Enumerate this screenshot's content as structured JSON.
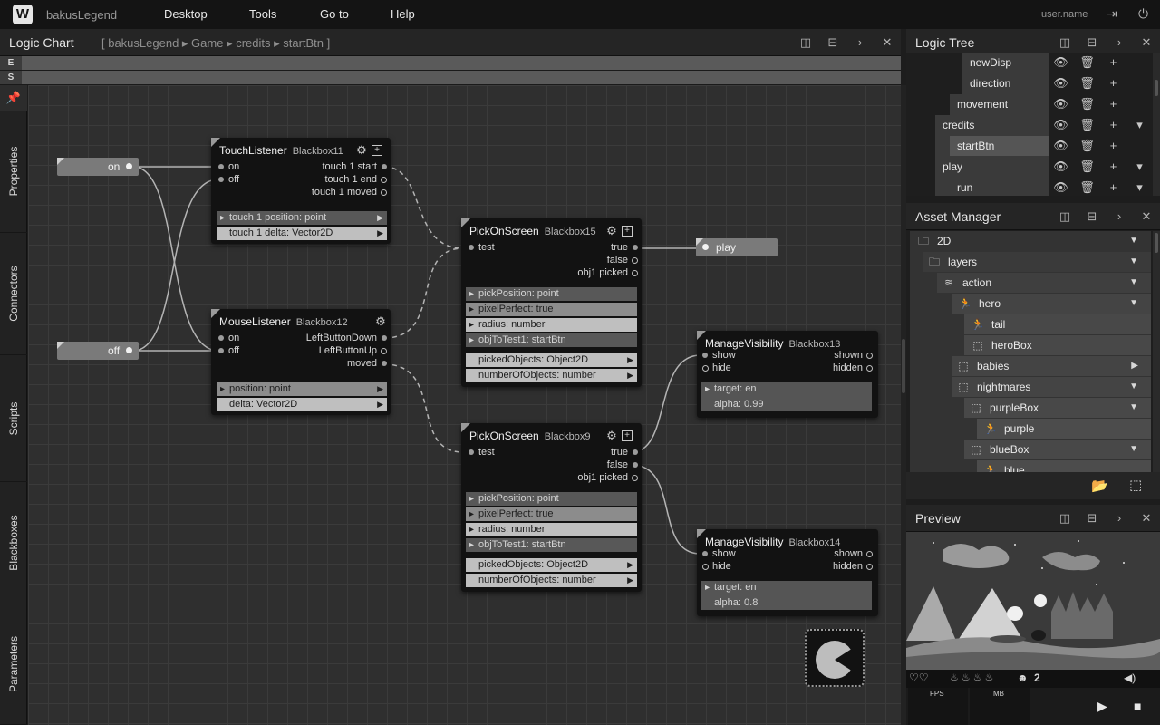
{
  "app": {
    "logo": "W",
    "name": "bakusLegend"
  },
  "menu": {
    "items": [
      "Desktop",
      "Tools",
      "Go to",
      "Help"
    ],
    "username": "user.name"
  },
  "logic_chart": {
    "title": "Logic Chart",
    "breadcrumb": "[ bakusLegend ▸ Game ▸ credits ▸ startBtn ]",
    "es": [
      "E",
      "S"
    ],
    "sidebar_tabs": [
      "Properties",
      "Connectors",
      "Scripts",
      "Blackboxes",
      "Parameters"
    ],
    "value_nodes": {
      "on": "on",
      "off": "off",
      "play": "play"
    },
    "nodes": {
      "touch": {
        "title": "TouchListener",
        "id": "Blackbox11",
        "inputs": [
          "on",
          "off"
        ],
        "outputs": [
          "touch 1 start",
          "touch 1 end",
          "touch 1 moved"
        ],
        "params": [
          "touch 1 position: point",
          "touch 1 delta: Vector2D"
        ]
      },
      "mouse": {
        "title": "MouseListener",
        "id": "Blackbox12",
        "inputs": [
          "on",
          "off"
        ],
        "outputs": [
          "LeftButtonDown",
          "LeftButtonUp",
          "moved"
        ],
        "params": [
          "position: point",
          "delta: Vector2D"
        ]
      },
      "pick15": {
        "title": "PickOnScreen",
        "id": "Blackbox15",
        "inputs": [
          "test"
        ],
        "outputs": [
          "true",
          "false",
          "obj1 picked"
        ],
        "params": [
          "pickPosition: point",
          "pixelPerfect: true",
          "radius: number",
          "objToTest1: startBtn"
        ],
        "results": [
          "pickedObjects: Object2D",
          "numberOfObjects: number"
        ]
      },
      "pick9": {
        "title": "PickOnScreen",
        "id": "Blackbox9",
        "inputs": [
          "test"
        ],
        "outputs": [
          "true",
          "false",
          "obj1 picked"
        ],
        "params": [
          "pickPosition: point",
          "pixelPerfect: true",
          "radius: number",
          "objToTest1: startBtn"
        ],
        "results": [
          "pickedObjects: Object2D",
          "numberOfObjects: number"
        ]
      },
      "vis13": {
        "title": "ManageVisibility",
        "id": "Blackbox13",
        "inputs": [
          "show",
          "hide"
        ],
        "outputs": [
          "shown",
          "hidden"
        ],
        "params": [
          "target: en",
          "alpha: 0.99"
        ]
      },
      "vis14": {
        "title": "ManageVisibility",
        "id": "Blackbox14",
        "inputs": [
          "show",
          "hide"
        ],
        "outputs": [
          "shown",
          "hidden"
        ],
        "params": [
          "target: en",
          "alpha: 0.8"
        ]
      }
    }
  },
  "logic_tree": {
    "title": "Logic Tree",
    "rows": [
      {
        "label": "newDisp"
      },
      {
        "label": "direction"
      },
      {
        "label": "movement"
      },
      {
        "label": "credits"
      },
      {
        "label": "startBtn"
      },
      {
        "label": "play"
      },
      {
        "label": "run"
      }
    ]
  },
  "asset_manager": {
    "title": "Asset Manager",
    "rows": [
      {
        "label": "2D",
        "icon": "folder-icon",
        "toggle": "▼"
      },
      {
        "label": "layers",
        "icon": "folder-icon",
        "toggle": "▼"
      },
      {
        "label": "action",
        "icon": "layers-icon",
        "toggle": "▼"
      },
      {
        "label": "hero",
        "icon": "runner-icon",
        "toggle": "▼"
      },
      {
        "label": "tail",
        "icon": "runner-icon",
        "toggle": ""
      },
      {
        "label": "heroBox",
        "icon": "bounding-box-icon",
        "toggle": ""
      },
      {
        "label": "babies",
        "icon": "bounding-box-icon",
        "toggle": "▶"
      },
      {
        "label": "nightmares",
        "icon": "bounding-box-icon",
        "toggle": "▼"
      },
      {
        "label": "purpleBox",
        "icon": "bounding-box-icon",
        "toggle": "▼"
      },
      {
        "label": "purple",
        "icon": "runner-icon",
        "toggle": ""
      },
      {
        "label": "blueBox",
        "icon": "bounding-box-icon",
        "toggle": "▼"
      },
      {
        "label": "blue",
        "icon": "runner-icon",
        "toggle": ""
      }
    ]
  },
  "preview": {
    "title": "Preview",
    "hud_count": "2",
    "stats": [
      "FPS",
      "MB"
    ]
  }
}
